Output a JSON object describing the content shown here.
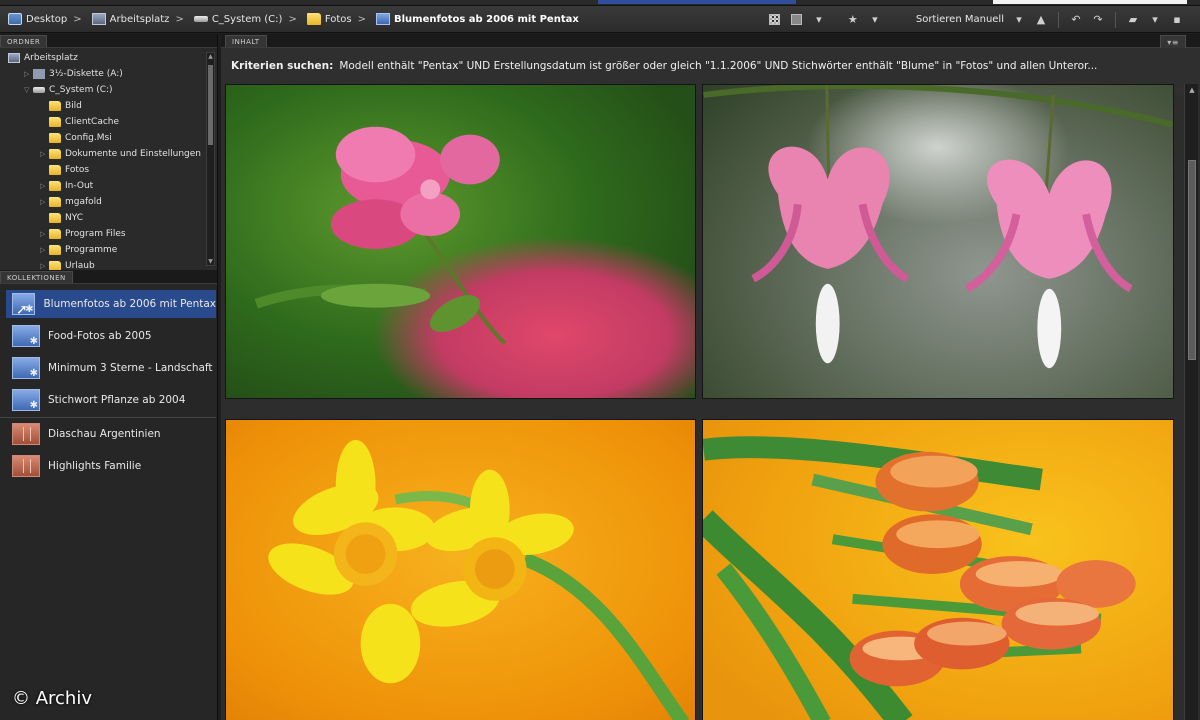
{
  "breadcrumb": [
    {
      "label": "Desktop",
      "icon": "desktop-icon"
    },
    {
      "label": "Arbeitsplatz",
      "icon": "computer-icon"
    },
    {
      "label": "C_System (C:)",
      "icon": "drive-icon"
    },
    {
      "label": "Fotos",
      "icon": "folder-icon"
    },
    {
      "label": "Blumenfotos ab 2006 mit Pentax",
      "icon": "smart-collection-icon"
    }
  ],
  "toolbar": {
    "sort_label": "Sortieren Manuell",
    "sort_arrow": "▾",
    "caret_up": "▲",
    "star": "★",
    "dropdown": "▾",
    "rotate_left": "↶",
    "rotate_right": "↷",
    "folder_glyph": "▰",
    "trash_glyph": "▪"
  },
  "panels": {
    "folders_tab": "ORDNER",
    "collections_tab": "KOLLEKTIONEN",
    "content_tab": "INHALT"
  },
  "folder_tree": [
    {
      "label": "Arbeitsplatz",
      "icon": "computer-icon",
      "arrow": ""
    },
    {
      "label": "3½-Diskette (A:)",
      "icon": "floppy-icon",
      "arrow": "▷"
    },
    {
      "label": "C_System (C:)",
      "icon": "drive-icon",
      "arrow": "▽"
    },
    {
      "label": "Bild",
      "icon": "folder-icon",
      "arrow": ""
    },
    {
      "label": "ClientCache",
      "icon": "folder-icon",
      "arrow": ""
    },
    {
      "label": "Config.Msi",
      "icon": "folder-icon",
      "arrow": ""
    },
    {
      "label": "Dokumente und Einstellungen",
      "icon": "folder-icon",
      "arrow": "▷"
    },
    {
      "label": "Fotos",
      "icon": "folder-icon",
      "arrow": ""
    },
    {
      "label": "In-Out",
      "icon": "folder-icon",
      "arrow": "▷"
    },
    {
      "label": "mgafold",
      "icon": "folder-icon",
      "arrow": "▷"
    },
    {
      "label": "NYC",
      "icon": "folder-icon",
      "arrow": ""
    },
    {
      "label": "Program Files",
      "icon": "folder-icon",
      "arrow": "▷"
    },
    {
      "label": "Programme",
      "icon": "folder-icon",
      "arrow": "▷"
    },
    {
      "label": "Urlaub",
      "icon": "folder-icon",
      "arrow": "▷"
    }
  ],
  "collections": [
    {
      "label": "Blumenfotos ab 2006 mit Pentax",
      "type": "smart",
      "selected": true
    },
    {
      "label": "Food-Fotos ab 2005",
      "type": "smart",
      "selected": false
    },
    {
      "label": "Minimum 3 Sterne - Landschaft",
      "type": "smart",
      "selected": false
    },
    {
      "label": "Stichwort Pflanze ab 2004",
      "type": "smart",
      "selected": false
    },
    {
      "label": "Diaschau Argentinien",
      "type": "manual",
      "selected": false
    },
    {
      "label": "Highlights Familie",
      "type": "manual",
      "selected": false
    }
  ],
  "criteria": {
    "label": "Kriterien suchen:",
    "text": "Modell enthält \"Pentax\" UND Erstellungsdatum ist größer oder gleich \"1.1.2006\" UND Stichwörter enthält \"Blume\" in \"Fotos\" und allen Unteror..."
  },
  "copyright": "© Archiv",
  "colors": {
    "selection": "#294a8c",
    "panel_bg": "#262626",
    "toolbar_bg": "#2b2b2b"
  }
}
